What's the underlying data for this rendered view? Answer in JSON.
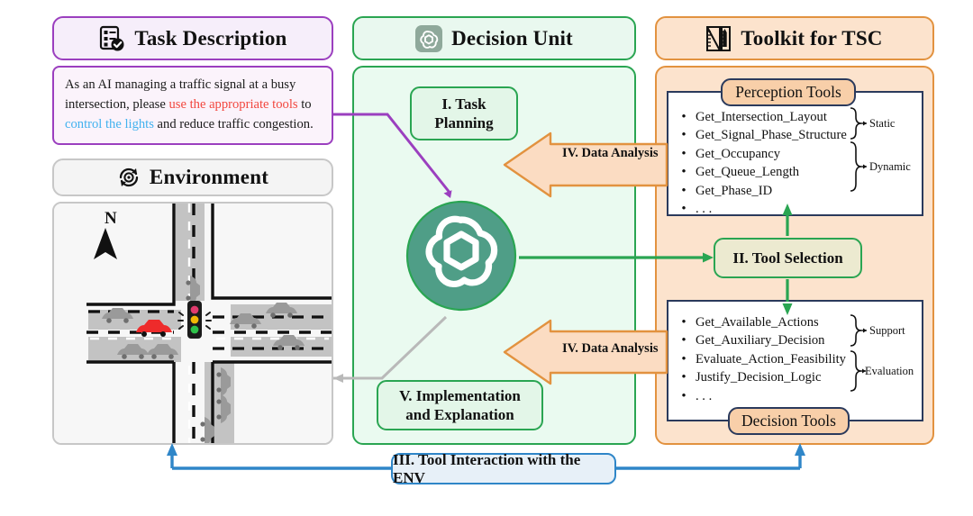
{
  "task": {
    "header": "Task Description",
    "header_icon": "checklist-icon",
    "body_parts": {
      "p1": "As an AI managing a traffic signal at a busy intersection, please ",
      "p2_red": "use the appropriate tools",
      "p3": " to ",
      "p4_blue": "control the lights",
      "p5": " and reduce traffic congestion."
    },
    "colors": {
      "border": "#9b3fbf",
      "red": "#f2473f",
      "blue": "#42b2ef"
    }
  },
  "environment": {
    "header": "Environment",
    "header_icon": "environment-cycle-icon",
    "compass_label": "N",
    "signal_lights": [
      "red",
      "amber",
      "green"
    ],
    "cars": {
      "highlight_color": "#ee2b2b",
      "normal_color": "#9a9a9a"
    }
  },
  "decision_unit": {
    "header": "Decision Unit",
    "header_icon": "openai-logo-icon",
    "center_icon": "openai-logo-icon",
    "center_color": "#4f9e87",
    "steps": [
      {
        "id": "task-planning",
        "label": "I. Task\nPlanning",
        "line1": "I. Task",
        "line2": "Planning"
      },
      {
        "id": "implementation",
        "label": "V. Implementation and Explanation",
        "line1": "V. Implementation",
        "line2": "and Explanation"
      }
    ],
    "colors": {
      "border": "#2aa552",
      "panel": "#eafaf0",
      "box": "#e3f6e8"
    }
  },
  "toolkit": {
    "header": "Toolkit for TSC",
    "header_icon": "ruler-pencil-icon",
    "perception": {
      "caption": "Perception Tools",
      "items": [
        "Get_Intersection_Layout",
        "Get_Signal_Phase_Structure",
        "Get_Occupancy",
        "Get_Queue_Length",
        "Get_Phase_ID",
        ". . ."
      ],
      "groups": [
        {
          "label": "Static",
          "from": 0,
          "to": 1
        },
        {
          "label": "Dynamic",
          "from": 2,
          "to": 5
        }
      ]
    },
    "decision": {
      "caption": "Decision Tools",
      "items": [
        "Get_Available_Actions",
        "Get_Auxiliary_Decision",
        "Evaluate_Action_Feasibility",
        "Justify_Decision_Logic",
        ". . ."
      ],
      "groups": [
        {
          "label": "Support",
          "from": 0,
          "to": 1
        },
        {
          "label": "Evaluation",
          "from": 2,
          "to": 4
        }
      ]
    },
    "tool_selection": "II. Tool Selection",
    "colors": {
      "border": "#e2923f",
      "panel": "#fce3cd",
      "cap": "#f8cfa9",
      "inner_border": "#2b3a5c"
    }
  },
  "flows": {
    "data_analysis_top": "IV. Data Analysis",
    "data_analysis_bottom": "IV. Data Analysis",
    "bottom_bar": "III. Tool Interaction with the ENV",
    "colors": {
      "orange": "#e2923f",
      "orange_fill": "#fbdcc2",
      "blue": "#2f86c8",
      "green": "#2aa552",
      "grey": "#b9b9b9",
      "purple": "#9b3fbf"
    }
  }
}
